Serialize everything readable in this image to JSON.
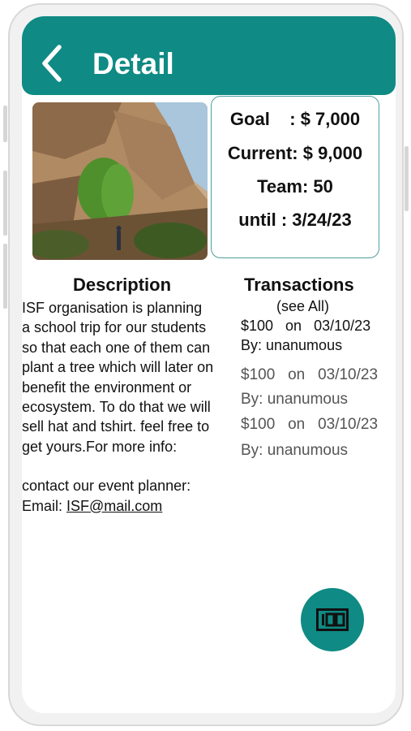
{
  "header": {
    "title": "Detail"
  },
  "stats": {
    "goal": "Goal    : $ 7,000",
    "current": "Current: $ 9,000",
    "team": "Team: 50",
    "until": "until : 3/24/23"
  },
  "description": {
    "heading": "Description",
    "lines": [
      "ISF organisation is planning",
      "a school trip for our students",
      "so that each one of them can",
      "plant a tree which will later on",
      "benefit the environment or",
      "ecosystem. To do that we will",
      "sell hat and tshirt. feel free to",
      "get yours.For more info:"
    ],
    "contact": "contact our event planner:",
    "email_label": "Email: ",
    "email": "ISF@mail.com"
  },
  "transactions": {
    "heading": "Transactions",
    "see_all": "(see All)",
    "items": [
      {
        "amount_line": "$100   on   03/10/23",
        "by": "By: unanumous"
      },
      {
        "amount_line": "$100   on   03/10/23",
        "by": "By: unanumous"
      },
      {
        "amount_line": "$100   on   03/10/23",
        "by": "By: unanumous"
      }
    ]
  },
  "fab": {
    "icon": "cash-100-icon",
    "icon_text": "100"
  },
  "colors": {
    "primary": "#0f8a84",
    "stats_border": "#4f9fa0"
  }
}
